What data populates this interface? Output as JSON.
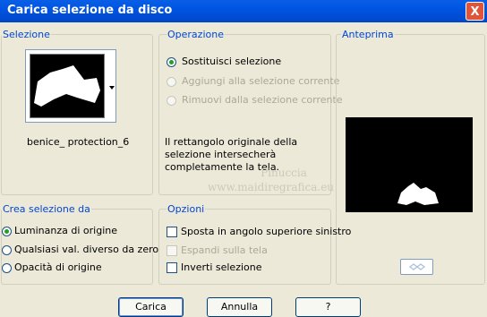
{
  "window": {
    "title": "Carica selezione da disco",
    "close_label": "X"
  },
  "selezione": {
    "label": "Selezione",
    "file_name": "benice_ protection_6"
  },
  "operazione": {
    "label": "Operazione",
    "options": [
      "Sostituisci selezione",
      "Aggiungi alla selezione corrente",
      "Rimuovi dalla selezione corrente"
    ],
    "info": "Il rettangolo originale della selezione intersecherà completamente la tela."
  },
  "anteprima": {
    "label": "Anteprima"
  },
  "crea": {
    "label": "Crea selezione da",
    "options": [
      "Luminanza di origine",
      "Qualsiasi val. diverso da zero",
      "Opacità di origine"
    ]
  },
  "opzioni": {
    "label": "Opzioni",
    "checks": [
      "Sposta in angolo superiore sinistro",
      "Espandi sulla tela",
      "Inverti selezione"
    ]
  },
  "watermark": {
    "line1": "Pinuccia",
    "line2": "www.maidiregrafica.eu"
  },
  "buttons": {
    "load": "Carica",
    "cancel": "Annulla",
    "help": "?"
  }
}
